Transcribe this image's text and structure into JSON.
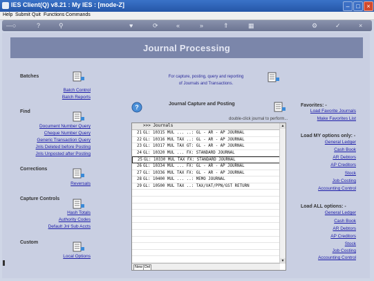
{
  "window": {
    "title": "IES Client(Q) v8.21 : My IES :        [mode-Z]"
  },
  "menu": [
    "Help",
    "Submit",
    "Quit",
    "Functions",
    "Commands"
  ],
  "toolbar": {
    "icons": [
      "key-icon",
      "help-icon",
      "search-icon",
      "heart-icon",
      "refresh-icon",
      "back-icon",
      "forward-icon",
      "export-icon",
      "calculator-icon",
      "gear-icon",
      "check-icon",
      "close-icon"
    ]
  },
  "page": {
    "title": "Journal Processing"
  },
  "left": {
    "batches": {
      "title": "Batches",
      "links": [
        "Batch Control",
        "Batch Reports"
      ]
    },
    "find": {
      "title": "Find",
      "links": [
        "Document Number Query",
        "Cheque Number Query",
        "Generic Transaction Query",
        "Jnls Deleted before Posting",
        "Jnls Unposted after Posting"
      ]
    },
    "corrections": {
      "title": "Corrections",
      "links": [
        "Reversals"
      ]
    },
    "capture": {
      "title": "Capture Controls",
      "links": [
        "Hash Totals",
        "Authority Codes",
        "Default Jnl Sub Accts"
      ]
    },
    "custom": {
      "title": "Custom",
      "links": [
        "Local Options"
      ]
    }
  },
  "center": {
    "desc1": "For capture, posting, query and reporting",
    "desc2": "of Journals and Transactions.",
    "jcp_title": "Journal Capture and Posting",
    "hint": "double-click journal to perform...",
    "grid": {
      "header": ">>> Journals",
      "rows": [
        {
          "n": "21",
          "text": "GL: 10315 MUL ... ..: GL - AR - AP JOURNAL"
        },
        {
          "n": "22",
          "text": "GL: 10316 MUL TAX ..: GL - AR - AP JOURNAL"
        },
        {
          "n": "23",
          "text": "GL: 10317 MUL TAX GT: GL - AR - AP JOURNAL"
        },
        {
          "n": "24",
          "text": "GL: 10320 MUL ... FX: STANDARD JOURNAL"
        },
        {
          "n": "25",
          "text": "GL: 10330 MUL TAX FX: STANDARD JOURNAL"
        },
        {
          "n": "26",
          "text": "GL: 10334 MUL ... FX: GL - AR - AP JOURNAL"
        },
        {
          "n": "27",
          "text": "GL: 10336 MUL TAX FX: GL - AR - AP JOURNAL"
        },
        {
          "n": "28",
          "text": "GL: 10400 MUL ... ..: MEMO JOURNAL"
        },
        {
          "n": "29",
          "text": "GL: 10500 MUL TAX ..: TAX/VAT/PPN/GST RETURN"
        }
      ],
      "selected_row": "25",
      "footer_buttons": [
        "New",
        "Del"
      ]
    }
  },
  "right": {
    "favorites": {
      "title": "Favorites: -",
      "links": [
        "Load Favorite Journals",
        "Make Favorites List"
      ]
    },
    "my_options": {
      "title": "Load MY options only: -",
      "links": [
        "General Ledger",
        "Cash Book",
        "AR Debtors",
        "AP Creditors",
        "Stock",
        "Job Costing",
        "Accounting Control"
      ]
    },
    "all_options": {
      "title": "Load ALL options: -",
      "links": [
        "General Ledger",
        "Cash Book",
        "AR Debtors",
        "AP Creditors",
        "Stock",
        "Job Costing",
        "Accounting Control"
      ]
    }
  }
}
